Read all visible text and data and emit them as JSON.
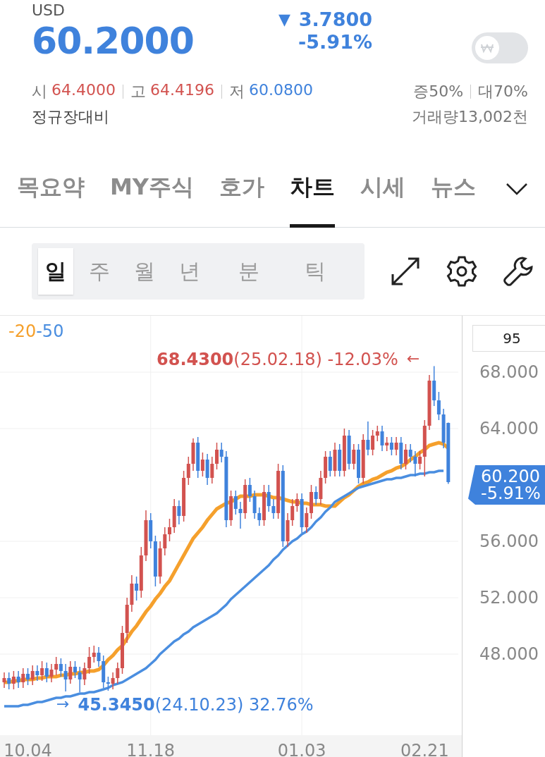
{
  "quote": {
    "currency": "USD",
    "price": "60.2000",
    "change_arrow": "▼",
    "change": "3.7800",
    "change_rate": "-5.91%",
    "krw_toggle": {
      "on": false
    }
  },
  "stats": [
    {
      "label": "시",
      "value": "64.4000",
      "color": "#d2524f"
    },
    {
      "label": "고",
      "value": "64.4196",
      "color": "#d2524f"
    },
    {
      "label": "저",
      "value": "60.0800",
      "color": "#3f82dc"
    }
  ],
  "margins": [
    "증50%",
    "대70%"
  ],
  "basis": "정규장대비",
  "volume": "거래량13,002천",
  "tabs": [
    {
      "label": "목요약",
      "selected": false
    },
    {
      "label": "MY주식",
      "selected": false
    },
    {
      "label": "호가",
      "selected": false
    },
    {
      "label": "차트",
      "selected": true
    },
    {
      "label": "시세",
      "selected": false
    },
    {
      "label": "뉴스",
      "selected": false
    }
  ],
  "periods": [
    {
      "label": "일",
      "selected": true
    },
    {
      "label": "주",
      "selected": false
    },
    {
      "label": "월",
      "selected": false
    },
    {
      "label": "년",
      "selected": false
    },
    {
      "label": "분",
      "selected": false
    },
    {
      "label": "틱",
      "selected": false
    }
  ],
  "chart": {
    "candle_count": "95",
    "high_note": {
      "text": "**68.4300**(25.02.18) -12.03%",
      "arrow": "←"
    },
    "low_note": {
      "text": "**45.3450**(24.10.23) 32.76%",
      "arrow": "→"
    },
    "current_marker": {
      "price": "60.200",
      "rate": "-5.91%"
    },
    "chart_data": {
      "type": "candlestick",
      "ylim": [
        42.25,
        72
      ],
      "grid": true,
      "yticks": [
        {
          "value": 68,
          "label": "68.000"
        },
        {
          "value": 64,
          "label": "64.000"
        },
        {
          "value": 56,
          "label": "56.000"
        },
        {
          "value": 52,
          "label": "52.000"
        },
        {
          "value": 48,
          "label": "48.000"
        }
      ],
      "categories": [
        null,
        null,
        null,
        null,
        null,
        "10.04",
        null,
        null,
        null,
        null,
        null,
        null,
        null,
        null,
        null,
        null,
        null,
        null,
        null,
        null,
        null,
        null,
        null,
        null,
        null,
        null,
        null,
        null,
        null,
        null,
        null,
        "11.18",
        null,
        null,
        null,
        null,
        null,
        null,
        null,
        null,
        null,
        null,
        null,
        null,
        null,
        null,
        null,
        null,
        null,
        null,
        null,
        null,
        null,
        null,
        null,
        null,
        null,
        null,
        null,
        null,
        null,
        null,
        null,
        "01.03",
        null,
        null,
        null,
        null,
        null,
        null,
        null,
        null,
        null,
        null,
        null,
        null,
        null,
        null,
        null,
        null,
        null,
        null,
        null,
        null,
        null,
        null,
        null,
        null,
        null,
        "02.21",
        null,
        null,
        null,
        null,
        null
      ],
      "ohlc": [
        [
          46.0,
          46.7,
          45.6,
          46.3
        ],
        [
          46.3,
          46.7,
          45.5,
          45.9
        ],
        [
          45.9,
          46.8,
          45.5,
          46.4
        ],
        [
          46.4,
          46.8,
          45.6,
          46.0
        ],
        [
          46.0,
          47.0,
          45.6,
          46.6
        ],
        [
          46.6,
          47.0,
          45.8,
          46.2
        ],
        [
          46.2,
          47.2,
          45.8,
          46.8
        ],
        [
          46.8,
          47.2,
          46.1,
          46.5
        ],
        [
          46.5,
          47.5,
          46.1,
          47.0
        ],
        [
          47.0,
          47.4,
          46.0,
          46.4
        ],
        [
          46.4,
          47.3,
          46.0,
          46.9
        ],
        [
          46.9,
          47.8,
          46.5,
          47.3
        ],
        [
          47.3,
          47.7,
          46.4,
          46.8
        ],
        [
          46.8,
          47.3,
          45.345,
          46.2
        ],
        [
          46.2,
          47.5,
          45.9,
          47.1
        ],
        [
          47.1,
          47.5,
          46.3,
          46.7
        ],
        [
          46.7,
          47.1,
          45.3,
          46.2
        ],
        [
          46.2,
          47.4,
          45.8,
          47.0
        ],
        [
          47.0,
          48.5,
          46.6,
          47.8
        ],
        [
          47.8,
          48.6,
          47.4,
          48.1
        ],
        [
          48.1,
          48.5,
          47.1,
          47.5
        ],
        [
          47.5,
          47.9,
          45.6,
          46.0
        ],
        [
          46.0,
          46.4,
          45.4,
          45.9
        ],
        [
          45.9,
          46.7,
          45.5,
          46.3
        ],
        [
          46.3,
          47.4,
          45.9,
          47.0
        ],
        [
          47.0,
          50.0,
          46.6,
          49.5
        ],
        [
          49.5,
          52.0,
          48.8,
          51.5
        ],
        [
          51.5,
          53.6,
          51.0,
          53.0
        ],
        [
          53.0,
          53.5,
          51.8,
          52.5
        ],
        [
          52.5,
          55.6,
          52.0,
          55.0
        ],
        [
          55.0,
          58.2,
          54.6,
          57.5
        ],
        [
          57.5,
          58.0,
          55.5,
          56.0
        ],
        [
          56.0,
          56.4,
          52.8,
          53.5
        ],
        [
          53.5,
          56.0,
          53.0,
          55.5
        ],
        [
          55.5,
          57.0,
          55.0,
          56.5
        ],
        [
          56.5,
          57.6,
          56.0,
          57.0
        ],
        [
          57.0,
          59.0,
          56.6,
          58.5
        ],
        [
          58.5,
          58.9,
          57.2,
          57.8
        ],
        [
          57.8,
          61.0,
          57.4,
          60.5
        ],
        [
          60.5,
          62.0,
          60.0,
          61.5
        ],
        [
          61.5,
          63.3,
          61.0,
          63.0
        ],
        [
          63.0,
          63.4,
          60.5,
          61.0
        ],
        [
          61.0,
          62.3,
          60.6,
          61.8
        ],
        [
          61.8,
          62.2,
          60.0,
          60.5
        ],
        [
          60.5,
          62.0,
          60.1,
          61.5
        ],
        [
          61.5,
          63.0,
          61.1,
          62.5
        ],
        [
          62.5,
          63.0,
          61.6,
          62.0
        ],
        [
          62.0,
          62.4,
          57.0,
          57.5
        ],
        [
          57.5,
          59.6,
          57.1,
          59.2
        ],
        [
          59.2,
          59.6,
          57.9,
          58.3
        ],
        [
          58.3,
          58.8,
          56.9,
          58.0
        ],
        [
          58.0,
          60.4,
          57.6,
          60.0
        ],
        [
          60.0,
          60.5,
          58.8,
          59.2
        ],
        [
          59.2,
          59.6,
          57.6,
          58.0
        ],
        [
          58.0,
          58.4,
          57.1,
          57.5
        ],
        [
          57.5,
          60.0,
          57.1,
          59.5
        ],
        [
          59.5,
          60.0,
          58.1,
          58.5
        ],
        [
          58.5,
          59.0,
          57.6,
          58.0
        ],
        [
          58.0,
          61.5,
          57.6,
          61.0
        ],
        [
          61.0,
          61.4,
          55.6,
          56.0
        ],
        [
          56.0,
          58.0,
          55.6,
          57.5
        ],
        [
          57.5,
          59.0,
          57.1,
          58.5
        ],
        [
          58.5,
          59.4,
          58.1,
          59.0
        ],
        [
          59.0,
          59.4,
          56.6,
          57.0
        ],
        [
          57.0,
          58.4,
          56.6,
          58.0
        ],
        [
          58.0,
          60.0,
          57.6,
          59.5
        ],
        [
          59.5,
          59.9,
          58.6,
          59.0
        ],
        [
          59.0,
          61.0,
          58.6,
          60.5
        ],
        [
          60.5,
          62.4,
          60.1,
          62.0
        ],
        [
          62.0,
          62.4,
          60.6,
          61.0
        ],
        [
          61.0,
          63.0,
          60.6,
          62.5
        ],
        [
          62.5,
          62.9,
          60.6,
          61.0
        ],
        [
          61.0,
          64.0,
          60.6,
          63.5
        ],
        [
          63.5,
          63.9,
          61.1,
          61.5
        ],
        [
          61.5,
          62.9,
          61.1,
          62.5
        ],
        [
          62.5,
          62.9,
          60.1,
          60.5
        ],
        [
          60.5,
          63.6,
          60.1,
          63.2
        ],
        [
          63.2,
          64.5,
          62.1,
          62.5
        ],
        [
          62.5,
          63.9,
          62.1,
          63.5
        ],
        [
          63.5,
          64.2,
          63.1,
          63.8
        ],
        [
          63.8,
          64.2,
          62.4,
          62.8
        ],
        [
          62.8,
          63.4,
          62.4,
          63.0
        ],
        [
          63.0,
          63.4,
          62.1,
          62.5
        ],
        [
          62.5,
          63.4,
          62.1,
          63.0
        ],
        [
          63.0,
          63.4,
          61.1,
          61.5
        ],
        [
          61.5,
          62.9,
          61.1,
          62.5
        ],
        [
          62.5,
          62.9,
          61.6,
          62.0
        ],
        [
          62.0,
          62.4,
          60.6,
          61.5
        ],
        [
          61.5,
          62.4,
          61.1,
          62.0
        ],
        [
          62.0,
          64.6,
          60.6,
          64.2
        ],
        [
          64.2,
          67.8,
          63.9,
          67.4
        ],
        [
          67.4,
          68.43,
          65.6,
          66.0
        ],
        [
          66.0,
          66.6,
          64.6,
          65.0
        ],
        [
          65.0,
          65.4,
          62.6,
          63.0
        ],
        [
          64.4,
          64.42,
          60.08,
          60.2
        ]
      ],
      "series": [
        {
          "name": "-20",
          "type": "line",
          "color": "#f5a02c",
          "values": [
            46.0,
            46.0,
            46.1,
            46.1,
            46.2,
            46.2,
            46.2,
            46.3,
            46.3,
            46.4,
            46.4,
            46.4,
            46.5,
            46.5,
            46.6,
            46.6,
            46.7,
            46.7,
            46.8,
            46.8,
            46.9,
            47.2,
            47.6,
            47.9,
            48.3,
            48.6,
            49.1,
            49.6,
            50.0,
            50.5,
            51.0,
            51.4,
            51.9,
            52.3,
            52.8,
            53.2,
            53.8,
            54.4,
            55.0,
            55.6,
            56.2,
            56.6,
            57.0,
            57.5,
            57.9,
            58.3,
            58.5,
            58.7,
            58.8,
            59.0,
            59.2,
            59.2,
            59.2,
            59.3,
            59.3,
            59.3,
            59.2,
            59.1,
            59.1,
            59.0,
            58.9,
            58.8,
            58.8,
            58.7,
            58.7,
            58.6,
            58.6,
            58.6,
            58.5,
            58.5,
            58.5,
            58.8,
            59.1,
            59.3,
            59.6,
            59.9,
            60.1,
            60.2,
            60.4,
            60.5,
            60.7,
            60.9,
            61.0,
            61.2,
            61.3,
            61.5,
            61.8,
            62.0,
            62.3,
            62.5,
            62.8,
            62.9,
            63.0,
            62.9,
            62.6
          ]
        },
        {
          "name": "-50",
          "type": "line",
          "color": "#4a8ee0",
          "values": [
            44.3,
            44.3,
            44.3,
            44.3,
            44.4,
            44.4,
            44.5,
            44.6,
            44.6,
            44.7,
            44.8,
            44.9,
            44.9,
            45.0,
            45.0,
            45.1,
            45.2,
            45.2,
            45.3,
            45.3,
            45.4,
            45.5,
            45.6,
            45.8,
            45.9,
            46.0,
            46.2,
            46.4,
            46.6,
            46.8,
            47.0,
            47.3,
            47.6,
            48.0,
            48.3,
            48.6,
            48.9,
            49.1,
            49.4,
            49.6,
            49.9,
            50.1,
            50.3,
            50.5,
            50.7,
            50.9,
            51.2,
            51.5,
            51.9,
            52.2,
            52.5,
            52.8,
            53.1,
            53.4,
            53.7,
            54.0,
            54.3,
            54.7,
            55.0,
            55.4,
            55.7,
            56.0,
            56.2,
            56.5,
            56.7,
            57.0,
            57.4,
            57.7,
            58.1,
            58.4,
            58.8,
            59.0,
            59.2,
            59.4,
            59.6,
            59.8,
            59.9,
            60.0,
            60.1,
            60.2,
            60.3,
            60.4,
            60.4,
            60.5,
            60.5,
            60.6,
            60.7,
            60.7,
            60.8,
            60.8,
            60.9,
            60.9,
            61.0,
            61.0,
            null
          ]
        }
      ]
    }
  }
}
